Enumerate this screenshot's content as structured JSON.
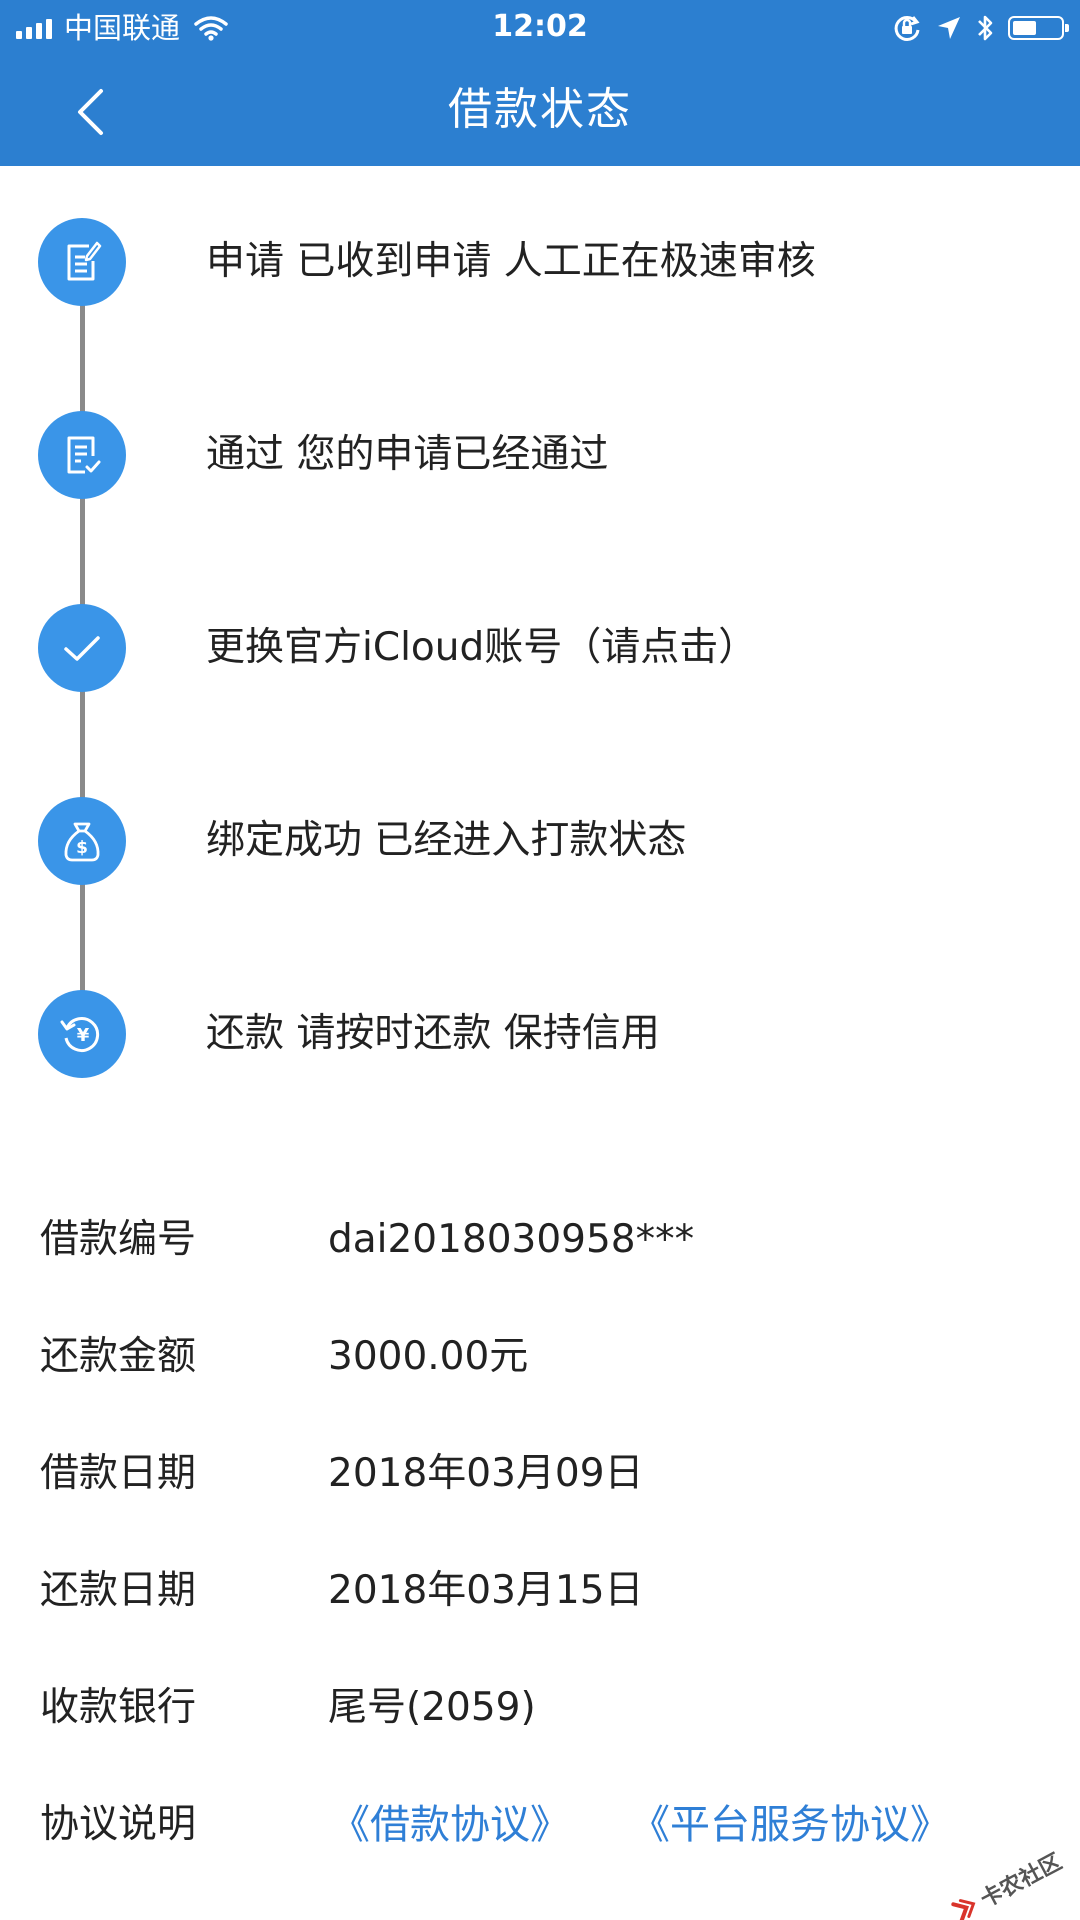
{
  "status_bar": {
    "carrier": "中国联通",
    "time": "12:02",
    "battery_level": 0.5
  },
  "nav": {
    "title": "借款状态"
  },
  "timeline": {
    "steps": [
      {
        "icon": "edit-document-icon",
        "text": "申请 已收到申请  人工正在极速审核"
      },
      {
        "icon": "document-check-icon",
        "text": "通过 您的申请已经通过"
      },
      {
        "icon": "checkmark-icon",
        "text": "更换官方iCloud账号（请点击）"
      },
      {
        "icon": "money-bag-icon",
        "text": "绑定成功 已经进入打款状态"
      },
      {
        "icon": "yen-refresh-icon",
        "text": "还款 请按时还款 保持信用"
      }
    ]
  },
  "details": {
    "loan_no": {
      "label": "借款编号",
      "value": "dai2018030958***"
    },
    "repay_amount": {
      "label": "还款金额",
      "value": "3000.00元"
    },
    "loan_date": {
      "label": "借款日期",
      "value": "2018年03月09日"
    },
    "repay_date": {
      "label": "还款日期",
      "value": "2018年03月15日"
    },
    "bank": {
      "label": "收款银行",
      "value": "尾号(2059)"
    },
    "agreement": {
      "label": "协议说明",
      "links": [
        "《借款协议》",
        "《平台服务协议》"
      ]
    }
  },
  "watermark": {
    "text": "卡农社区"
  },
  "colors": {
    "header": "#2c7fd0",
    "step_icon": "#3a95e8",
    "link": "#2f7fd6",
    "timeline_line": "#8a8a8a"
  }
}
